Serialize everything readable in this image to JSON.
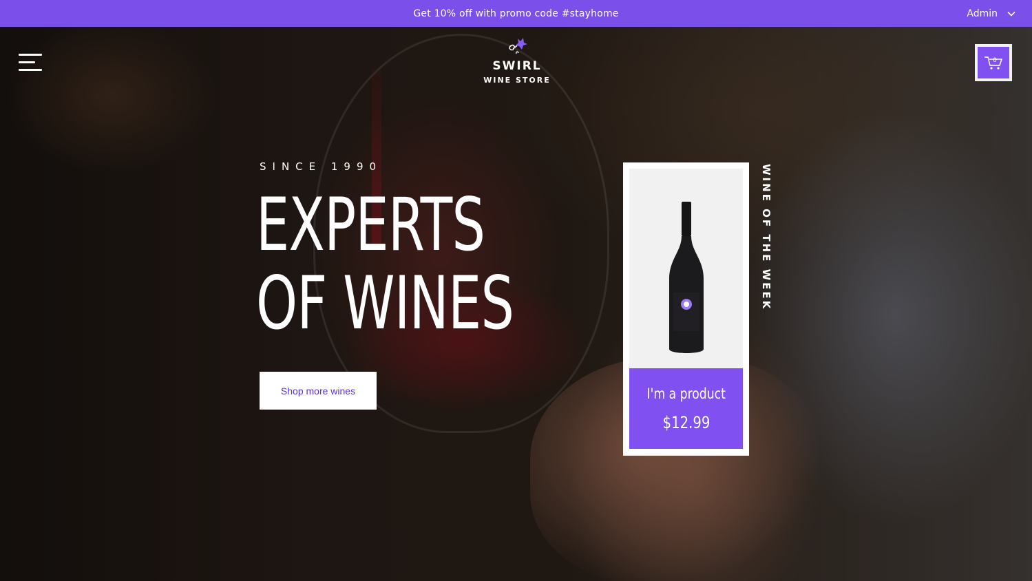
{
  "promo": {
    "text": "Get 10% off with promo code #stayhome"
  },
  "admin": {
    "label": "Admin"
  },
  "logo": {
    "name": "SWIRL",
    "tagline": "WINE STORE"
  },
  "cart": {
    "count": "0"
  },
  "hero": {
    "since": "SINCE 1990",
    "headline_line1": "EXPERTS",
    "headline_line2": "OF WINES",
    "cta_label": "Shop more wines"
  },
  "featured": {
    "vertical_label": "WINE OF THE WEEK",
    "product_name": "I'm a product",
    "price": "$12.99"
  },
  "colors": {
    "accent": "#7b4fe9",
    "button_text": "#5a33c9"
  },
  "icons": [
    "menu-icon",
    "chevron-down-icon",
    "cart-icon",
    "grape-logo-icon"
  ]
}
